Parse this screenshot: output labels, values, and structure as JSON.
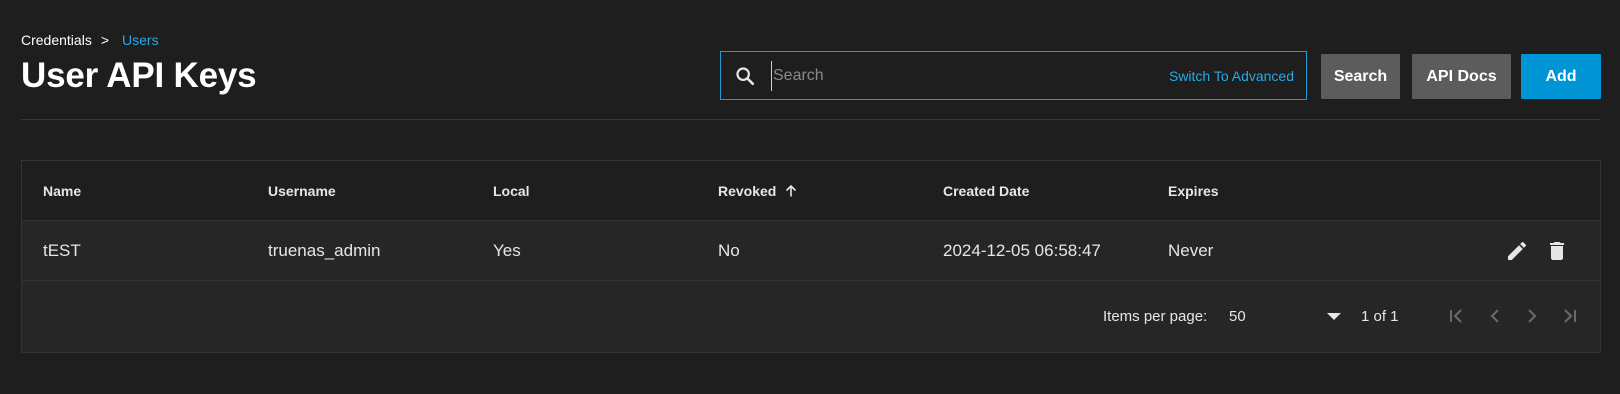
{
  "breadcrumb": {
    "parent": "Credentials",
    "separator": ">",
    "current": "Users"
  },
  "page": {
    "title": "User API Keys"
  },
  "search": {
    "placeholder": "Search",
    "value": "",
    "switch_label": "Switch To Advanced",
    "icon": "search-icon"
  },
  "toolbar": {
    "search_label": "Search",
    "api_docs_label": "API Docs",
    "add_label": "Add"
  },
  "table": {
    "columns": [
      "Name",
      "Username",
      "Local",
      "Revoked",
      "Created Date",
      "Expires"
    ],
    "sort_column": "Revoked",
    "sort_direction": "ascending",
    "rows": [
      {
        "name": "tEST",
        "username": "truenas_admin",
        "local": "Yes",
        "revoked": "No",
        "created_date": "2024-12-05 06:58:47",
        "expires": "Never",
        "actions": [
          "edit-icon",
          "delete-icon"
        ]
      }
    ]
  },
  "pagination": {
    "items_per_page_label": "Items per page:",
    "items_per_page": "50",
    "range_label": "1 of 1"
  },
  "colors": {
    "background": "#1e1e1e",
    "accent": "#0095d5",
    "link": "#27a9e9",
    "secondary_button": "#5c5c5c"
  }
}
